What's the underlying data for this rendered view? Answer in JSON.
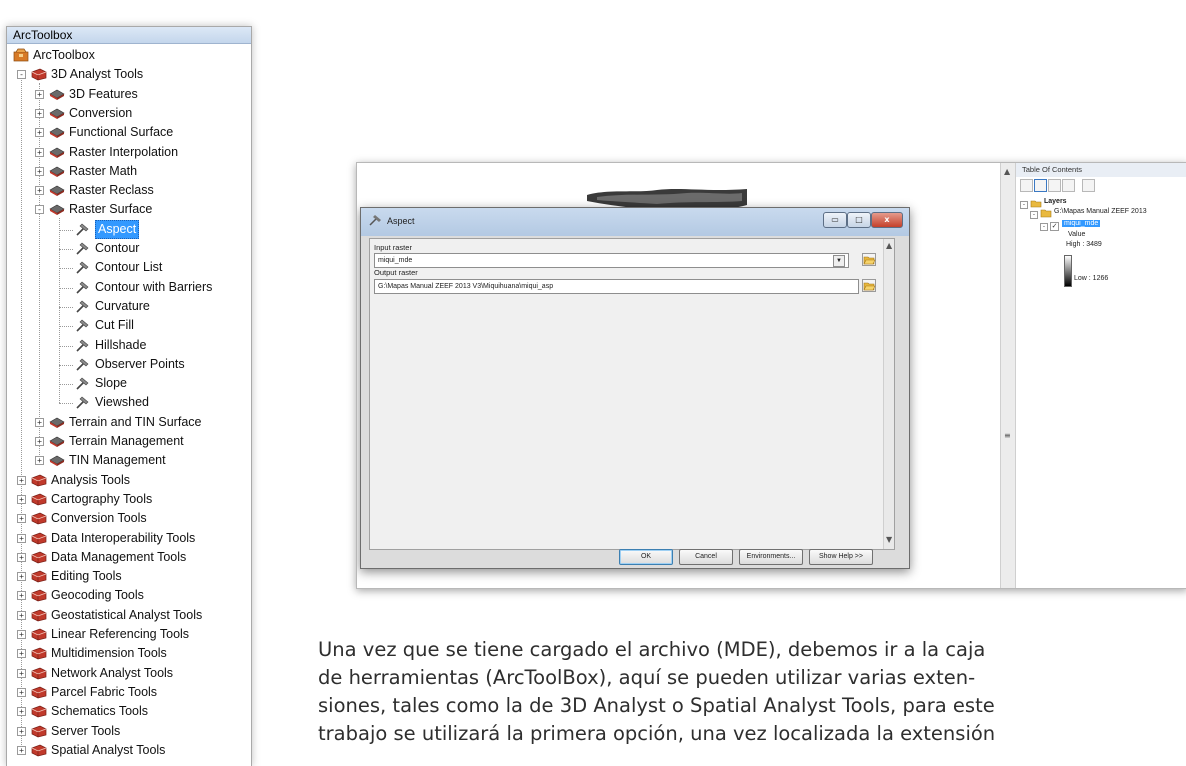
{
  "toolbox": {
    "window_title": "ArcToolbox",
    "items": [
      {
        "label": "ArcToolbox",
        "level": 0,
        "type": "root",
        "expander": ""
      },
      {
        "label": "3D Analyst Tools",
        "level": 1,
        "type": "toolbox",
        "expander": "-"
      },
      {
        "label": "3D Features",
        "level": 2,
        "type": "toolset",
        "expander": "+"
      },
      {
        "label": "Conversion",
        "level": 2,
        "type": "toolset",
        "expander": "+"
      },
      {
        "label": "Functional Surface",
        "level": 2,
        "type": "toolset",
        "expander": "+"
      },
      {
        "label": "Raster Interpolation",
        "level": 2,
        "type": "toolset",
        "expander": "+"
      },
      {
        "label": "Raster Math",
        "level": 2,
        "type": "toolset",
        "expander": "+"
      },
      {
        "label": "Raster Reclass",
        "level": 2,
        "type": "toolset",
        "expander": "+"
      },
      {
        "label": "Raster Surface",
        "level": 2,
        "type": "toolset",
        "expander": "-"
      },
      {
        "label": "Aspect",
        "level": 3,
        "type": "tool",
        "expander": "",
        "selected": true
      },
      {
        "label": "Contour",
        "level": 3,
        "type": "tool",
        "expander": ""
      },
      {
        "label": "Contour List",
        "level": 3,
        "type": "tool",
        "expander": ""
      },
      {
        "label": "Contour with Barriers",
        "level": 3,
        "type": "tool",
        "expander": ""
      },
      {
        "label": "Curvature",
        "level": 3,
        "type": "tool",
        "expander": ""
      },
      {
        "label": "Cut Fill",
        "level": 3,
        "type": "tool",
        "expander": ""
      },
      {
        "label": "Hillshade",
        "level": 3,
        "type": "tool",
        "expander": ""
      },
      {
        "label": "Observer Points",
        "level": 3,
        "type": "tool",
        "expander": ""
      },
      {
        "label": "Slope",
        "level": 3,
        "type": "tool",
        "expander": ""
      },
      {
        "label": "Viewshed",
        "level": 3,
        "type": "tool",
        "expander": ""
      },
      {
        "label": "Terrain and TIN Surface",
        "level": 2,
        "type": "toolset",
        "expander": "+"
      },
      {
        "label": "Terrain Management",
        "level": 2,
        "type": "toolset",
        "expander": "+"
      },
      {
        "label": "TIN Management",
        "level": 2,
        "type": "toolset",
        "expander": "+"
      },
      {
        "label": "Analysis Tools",
        "level": 1,
        "type": "toolbox",
        "expander": "+"
      },
      {
        "label": "Cartography Tools",
        "level": 1,
        "type": "toolbox",
        "expander": "+"
      },
      {
        "label": "Conversion Tools",
        "level": 1,
        "type": "toolbox",
        "expander": "+"
      },
      {
        "label": "Data Interoperability Tools",
        "level": 1,
        "type": "toolbox",
        "expander": "+"
      },
      {
        "label": "Data Management Tools",
        "level": 1,
        "type": "toolbox",
        "expander": "+"
      },
      {
        "label": "Editing Tools",
        "level": 1,
        "type": "toolbox",
        "expander": "+"
      },
      {
        "label": "Geocoding Tools",
        "level": 1,
        "type": "toolbox",
        "expander": "+"
      },
      {
        "label": "Geostatistical Analyst Tools",
        "level": 1,
        "type": "toolbox",
        "expander": "+"
      },
      {
        "label": "Linear Referencing Tools",
        "level": 1,
        "type": "toolbox",
        "expander": "+"
      },
      {
        "label": "Multidimension Tools",
        "level": 1,
        "type": "toolbox",
        "expander": "+"
      },
      {
        "label": "Network Analyst Tools",
        "level": 1,
        "type": "toolbox",
        "expander": "+"
      },
      {
        "label": "Parcel Fabric Tools",
        "level": 1,
        "type": "toolbox",
        "expander": "+"
      },
      {
        "label": "Schematics Tools",
        "level": 1,
        "type": "toolbox",
        "expander": "+"
      },
      {
        "label": "Server Tools",
        "level": 1,
        "type": "toolbox",
        "expander": "+"
      },
      {
        "label": "Spatial Analyst Tools",
        "level": 1,
        "type": "toolbox",
        "expander": "+"
      }
    ]
  },
  "dialog": {
    "title": "Aspect",
    "input_label": "Input raster",
    "input_value": "miqui_mde",
    "output_label": "Output raster",
    "output_value": "G:\\Mapas Manual ZEEF 2013 V3\\Miquihuana\\miqui_asp",
    "buttons": {
      "ok": "OK",
      "cancel": "Cancel",
      "environments": "Environments...",
      "show_help": "Show Help >>"
    }
  },
  "toc": {
    "title": "Table Of Contents",
    "layers_label": "Layers",
    "path": "G:\\Mapas Manual ZEEF 2013",
    "layer": "miqui_mde",
    "value_label": "Value",
    "high": "High : 3489",
    "low": "Low : 1266"
  },
  "paragraph": {
    "lines": [
      "Una vez que se tiene cargado el archivo (MDE), debemos ir a la caja",
      "de herramientas (ArcToolBox), aquí se pueden utilizar varias exten-",
      "siones, tales como la de 3D Analyst o Spatial Analyst Tools, para este",
      "trabajo se utilizará la primera opción, una vez localizada la extensión"
    ]
  },
  "colors": {
    "selection": "#3399ff",
    "toolbox_red": "#c0392b",
    "toolset_gray": "#5a5a5a"
  }
}
